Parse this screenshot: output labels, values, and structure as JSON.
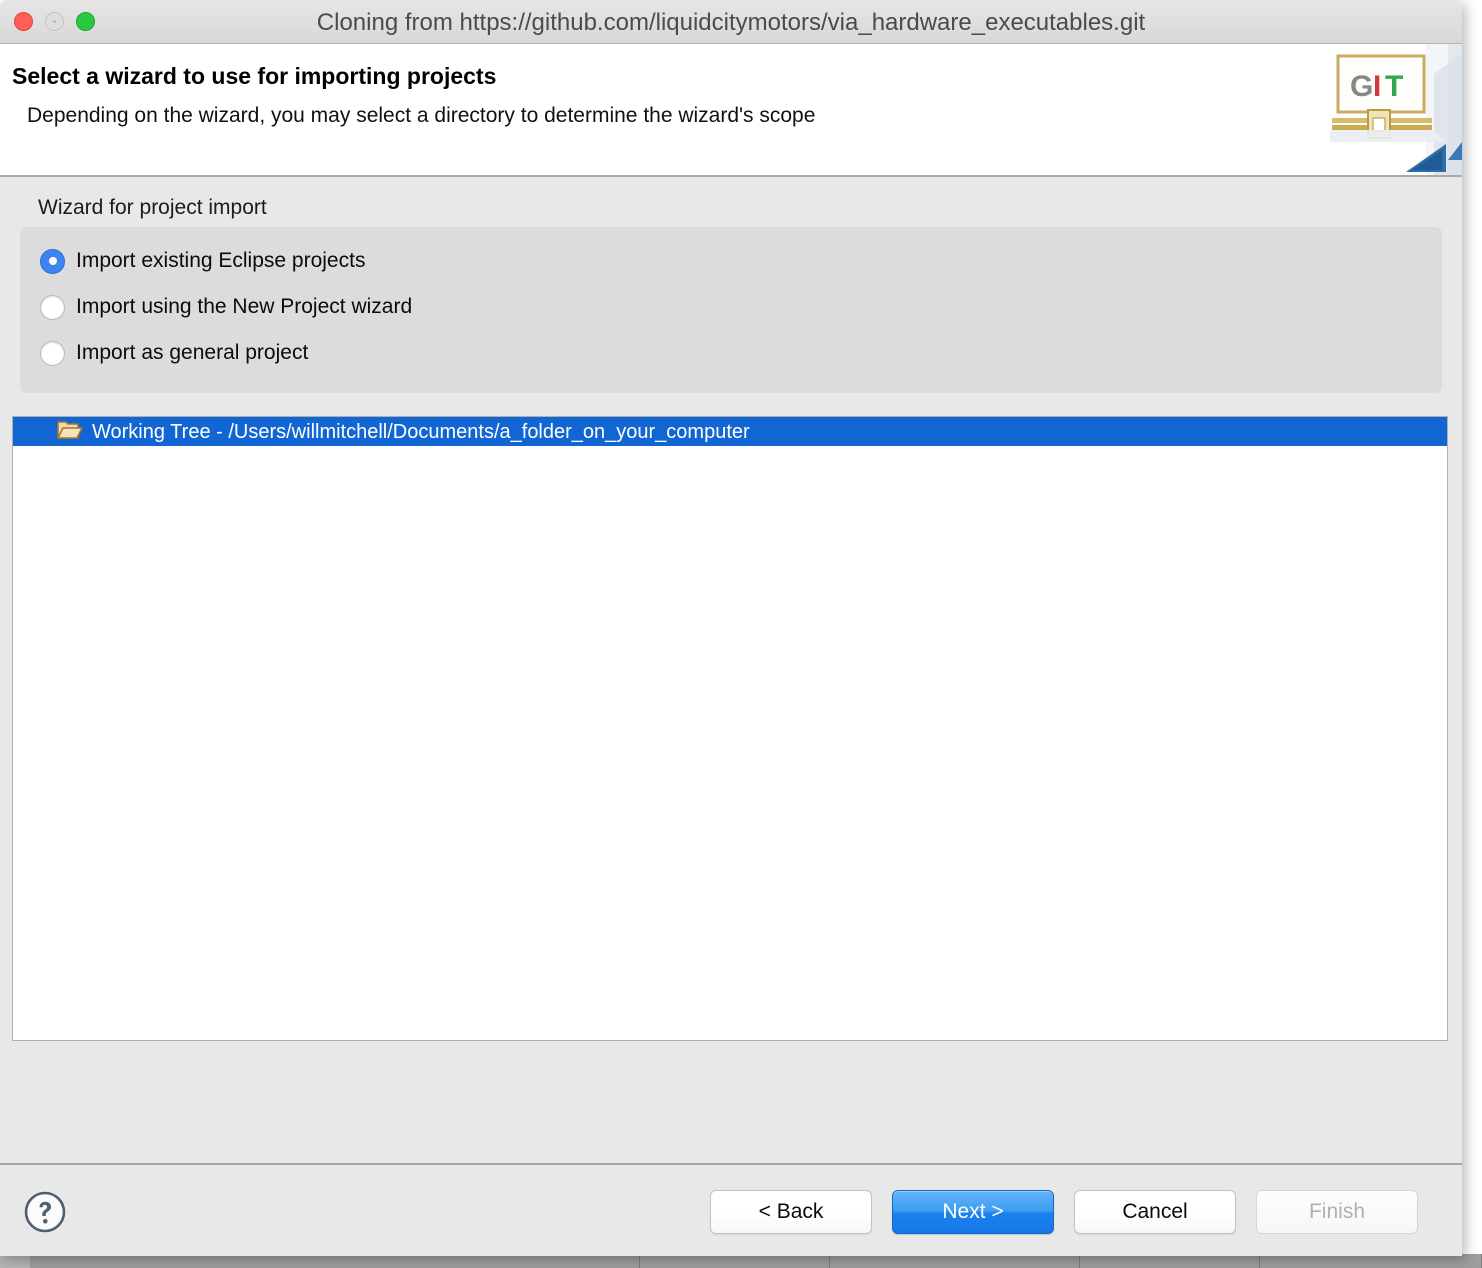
{
  "window": {
    "title": "Cloning from https://github.com/liquidcitymotors/via_hardware_executables.git",
    "traffic_lights": {
      "close": "close-button",
      "minimize": "minimize-button",
      "zoom": "zoom-button"
    }
  },
  "header": {
    "title": "Select a wizard to use for importing projects",
    "subtitle": "Depending on the wizard, you may select a directory to determine the wizard's scope",
    "banner_icon": "git-banner-icon",
    "banner_letters": {
      "g": "G",
      "i": "I",
      "t": "T"
    }
  },
  "wizard_group": {
    "label": "Wizard for project import",
    "options": [
      {
        "label": "Import existing Eclipse projects",
        "selected": true
      },
      {
        "label": "Import using the New Project wizard",
        "selected": false
      },
      {
        "label": "Import as general project",
        "selected": false
      }
    ]
  },
  "tree": {
    "rows": [
      {
        "icon": "open-folder-icon",
        "label": "Working Tree - /Users/willmitchell/Documents/a_folder_on_your_computer",
        "selected": true
      }
    ]
  },
  "footer": {
    "help_icon": "help-question-icon",
    "buttons": [
      {
        "label": "< Back",
        "style": "normal",
        "enabled": true
      },
      {
        "label": "Next >",
        "style": "primary",
        "enabled": true
      },
      {
        "label": "Cancel",
        "style": "normal",
        "enabled": true
      },
      {
        "label": "Finish",
        "style": "disabled",
        "enabled": false
      }
    ]
  },
  "colors": {
    "selection_blue": "#1266d4",
    "primary_button_blue": "#1a82ee",
    "radio_blue": "#3c85f0",
    "window_chrome": "#e8e8e8",
    "traffic_red": "#ff5f57",
    "traffic_green": "#28c840",
    "help_icon_slate": "#4f5d75"
  }
}
